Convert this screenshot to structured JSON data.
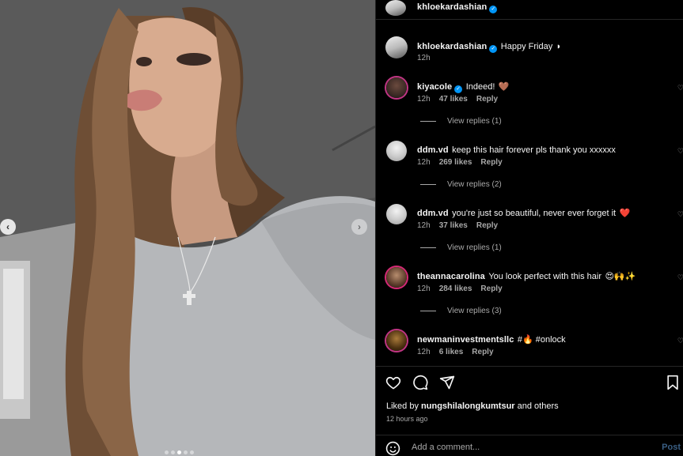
{
  "post": {
    "author": "khloekardashian",
    "caption": "Happy Friday",
    "caption_emoji": "◗",
    "caption_time": "12h"
  },
  "comments": [
    {
      "user": "kiyacole",
      "verified": true,
      "text": "Indeed!",
      "emoji": "🤎",
      "time": "12h",
      "likes": "47 likes",
      "reply": "Reply",
      "view_replies": "View replies (1)"
    },
    {
      "user": "ddm.vd",
      "verified": false,
      "text": "keep this hair forever pls thank you xxxxxx",
      "emoji": "",
      "time": "12h",
      "likes": "269 likes",
      "reply": "Reply",
      "view_replies": "View replies (2)"
    },
    {
      "user": "ddm.vd",
      "verified": false,
      "text": "you're just so beautiful, never ever forget it",
      "emoji": "❤️",
      "time": "12h",
      "likes": "37 likes",
      "reply": "Reply",
      "view_replies": "View replies (1)"
    },
    {
      "user": "theannacarolina",
      "verified": false,
      "text": "You look perfect with this hair",
      "emoji": "😍🙌✨",
      "time": "12h",
      "likes": "284 likes",
      "reply": "Reply",
      "view_replies": "View replies (3)"
    },
    {
      "user": "newmaninvestmentsllc",
      "verified": false,
      "text": "#🔥 #onlock",
      "emoji": "",
      "time": "12h",
      "likes": "6 likes",
      "reply": "Reply",
      "view_replies": ""
    }
  ],
  "likes_line": {
    "prefix": "Liked by ",
    "user": "nungshilalongkumtsur",
    "suffix": " and others"
  },
  "posted_time": "12 hours ago",
  "comment_box": {
    "placeholder": "Add a comment...",
    "post_label": "Post"
  },
  "carousel": {
    "count": 5,
    "active_index": 2
  },
  "icons": {
    "like": "heart-icon",
    "comment": "comment-icon",
    "share": "share-icon",
    "save": "bookmark-icon",
    "emoji": "emoji-icon",
    "prev": "chevron-left-icon",
    "next": "chevron-right-icon"
  },
  "colors": {
    "accent": "#0095f6",
    "muted": "#a8a8a8",
    "background": "#000000"
  }
}
